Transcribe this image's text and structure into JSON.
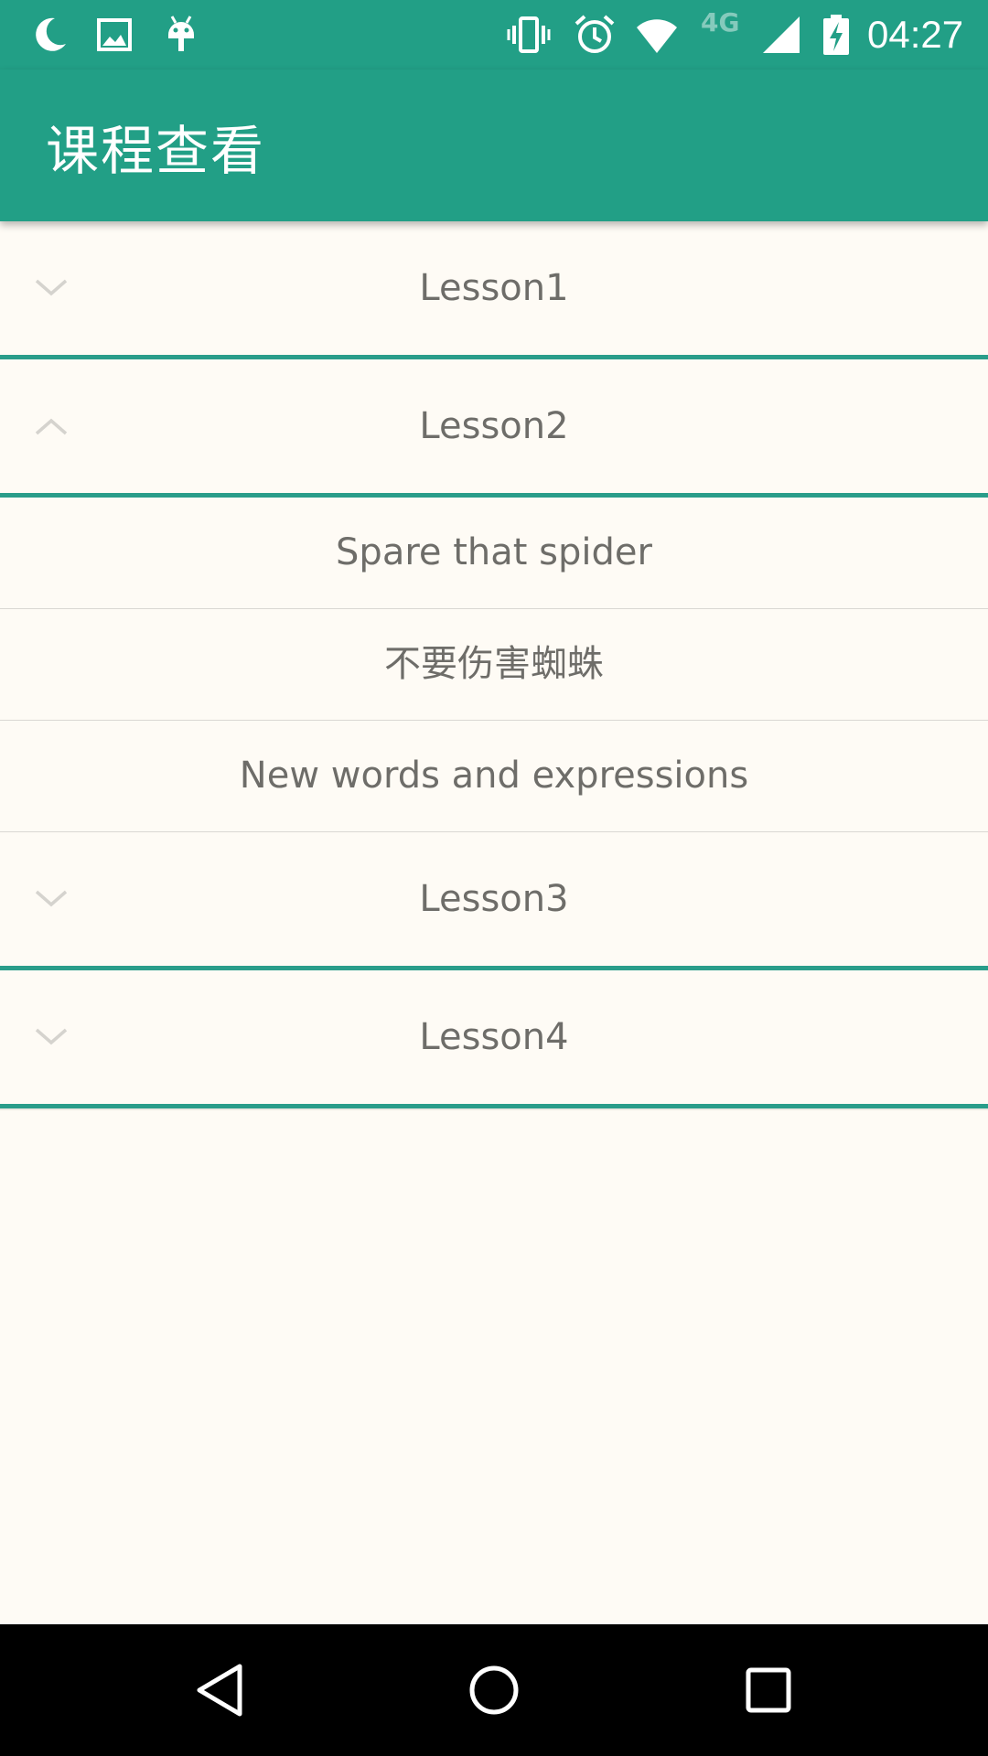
{
  "status_bar": {
    "network_label": "4G",
    "time": "04:27",
    "icons": [
      "moon-icon",
      "image-icon",
      "android-icon",
      "vibrate-icon",
      "alarm-icon",
      "wifi-icon",
      "signal-icon",
      "battery-charging-icon"
    ]
  },
  "toolbar": {
    "title": "课程查看",
    "background_color": "#229F86"
  },
  "list": {
    "groups": [
      {
        "label": "Lesson1",
        "expanded": false,
        "indicator_icon": "chevron-down-icon",
        "children": []
      },
      {
        "label": "Lesson2",
        "expanded": true,
        "indicator_icon": "chevron-up-icon",
        "children": [
          {
            "label": "Spare that spider"
          },
          {
            "label": "不要伤害蜘蛛"
          },
          {
            "label": "New words and expressions"
          }
        ]
      },
      {
        "label": "Lesson3",
        "expanded": false,
        "indicator_icon": "chevron-down-icon",
        "children": []
      },
      {
        "label": "Lesson4",
        "expanded": false,
        "indicator_icon": "chevron-down-icon",
        "children": []
      }
    ],
    "divider_color": "#2A9D8A",
    "text_color": "#6E6D69",
    "background_color": "#FEFBF5"
  },
  "nav_bar": {
    "buttons": [
      "back-icon",
      "home-icon",
      "recents-icon"
    ]
  }
}
